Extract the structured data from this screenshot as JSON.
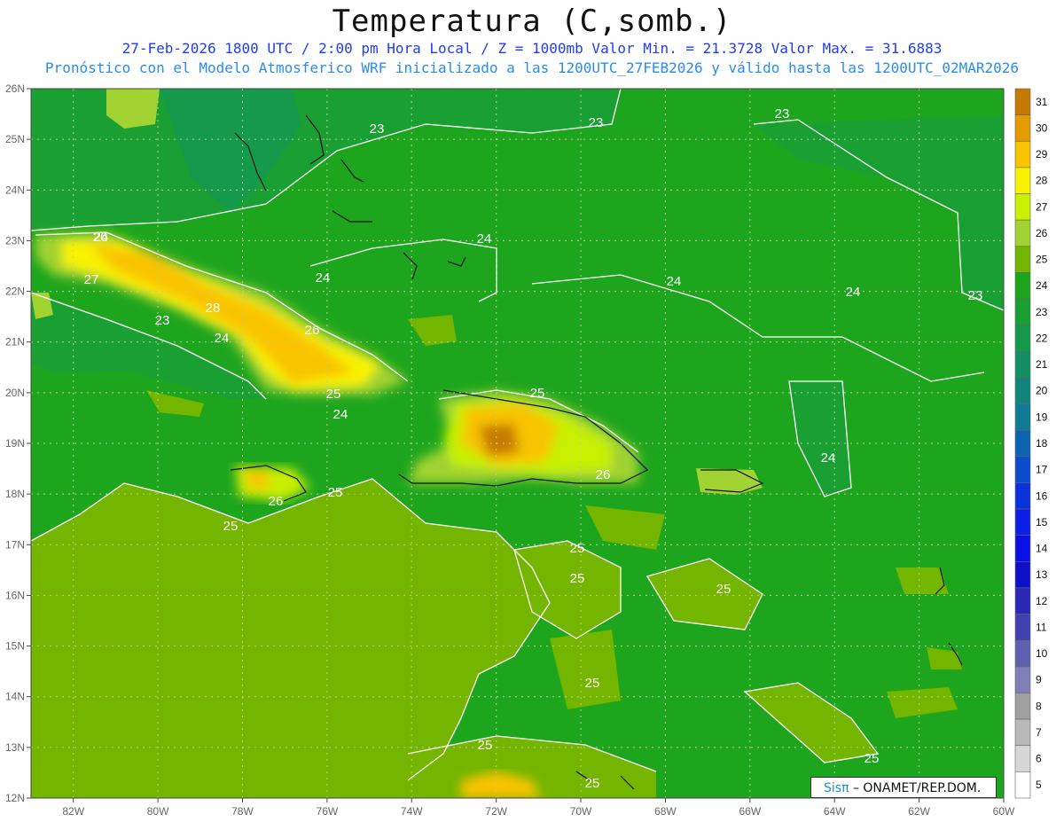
{
  "header": {
    "title": "Temperatura (C,somb.)",
    "subtitle1": "27-Feb-2026  1800 UTC / 2:00 pm Hora Local / Z = 1000mb   Valor Min. = 21.3728  Valor Max. = 31.6883",
    "subtitle2": "Pronóstico con el Modelo Atmosferico WRF inicializado a las 1200UTC_27FEB2026 y válido hasta las  1200UTC_02MAR2026"
  },
  "map": {
    "lon_range": [
      -83,
      -60
    ],
    "lat_range": [
      12,
      26
    ],
    "lon_ticks": [
      "82W",
      "80W",
      "78W",
      "76W",
      "74W",
      "72W",
      "70W",
      "68W",
      "66W",
      "64W",
      "62W",
      "60W"
    ],
    "lat_ticks": [
      "26N",
      "25N",
      "24N",
      "23N",
      "22N",
      "21N",
      "20N",
      "19N",
      "18N",
      "17N",
      "16N",
      "15N",
      "14N",
      "13N",
      "12N"
    ],
    "contour_labels": [
      "23",
      "23",
      "23",
      "23",
      "24",
      "24",
      "24",
      "24",
      "24",
      "24",
      "24",
      "25",
      "25",
      "25",
      "25",
      "25",
      "25",
      "25",
      "25",
      "25",
      "25",
      "26",
      "26",
      "26",
      "26",
      "27",
      "28",
      "23",
      "24",
      "25"
    ]
  },
  "legend": {
    "levels": [
      "31",
      "30",
      "29",
      "28",
      "27",
      "26",
      "25",
      "24",
      "23",
      "22",
      "21",
      "20",
      "19",
      "18",
      "17",
      "16",
      "15",
      "14",
      "13",
      "12",
      "11",
      "10",
      "9",
      "8",
      "7",
      "6",
      "5"
    ],
    "colors": [
      "#c47a00",
      "#e39b00",
      "#f9c300",
      "#f8f200",
      "#c8f000",
      "#a0d232",
      "#74b500",
      "#1ea51e",
      "#1aa032",
      "#159a4b",
      "#128f63",
      "#10857c",
      "#0f7a96",
      "#0c63b1",
      "#0a4ccc",
      "#0a32dc",
      "#0a20e6",
      "#0a10e6",
      "#1010c8",
      "#2828b4",
      "#4040b0",
      "#6060b0",
      "#8080b8",
      "#a0a0a0",
      "#b9b9b9",
      "#d6d6d6",
      "#ffffff"
    ]
  },
  "logo": {
    "brand": "Sisπ",
    "text": " – ONAMET/REP.DOM."
  }
}
